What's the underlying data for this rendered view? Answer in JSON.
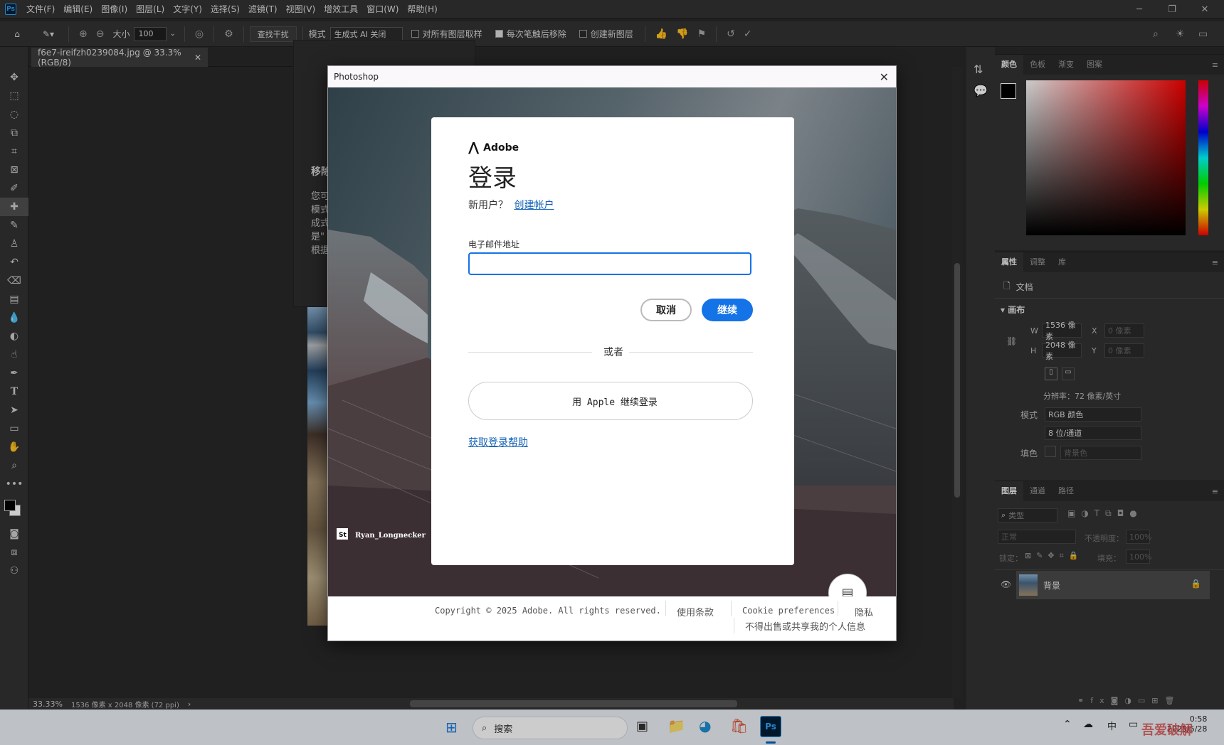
{
  "app": {
    "logo": "Ps",
    "menus": [
      "文件(F)",
      "编辑(E)",
      "图像(I)",
      "图层(L)",
      "文字(Y)",
      "选择(S)",
      "滤镜(T)",
      "视图(V)",
      "增效工具",
      "窗口(W)",
      "帮助(H)"
    ]
  },
  "options": {
    "size_label": "大小",
    "size_value": "100",
    "find_distraction": "查找干扰",
    "mode_label": "模式",
    "mode_value": "生成式 AI 关闭",
    "sample_all": "对所有图层取样",
    "remove_after_stroke": "每次笔触后移除",
    "create_layer": "创建新图层"
  },
  "document": {
    "tab_title": "f6e7-ireifzh0239084.jpg @ 33.3%(RGB/8)",
    "zoom": "33.33%",
    "info": "1536 像素 x 2048 像素 (72 ppi)"
  },
  "behind_popup": {
    "title": "移除",
    "lines": [
      "您可",
      "模式",
      "成式",
      "是\"",
      "根据"
    ]
  },
  "color_panel": {
    "tabs": [
      "颜色",
      "色板",
      "渐变",
      "图案"
    ]
  },
  "props_panel": {
    "tabs": [
      "属性",
      "调整",
      "库"
    ],
    "doc_label": "文档",
    "section": "画布",
    "w_label": "W",
    "w_value": "1536 像素",
    "x_label": "X",
    "x_value": "0 像素",
    "h_label": "H",
    "h_value": "2048 像素",
    "y_label": "Y",
    "y_value": "0 像素",
    "resolution": "分辨率：72 像素/英寸",
    "mode_label": "模式",
    "mode_value": "RGB 颜色",
    "depth_value": "8 位/通道",
    "fill_label": "填色",
    "fill_value": "背景色"
  },
  "layers_panel": {
    "tabs": [
      "图层",
      "通道",
      "路径"
    ],
    "filter": "类型",
    "blend": "正常",
    "opacity_label": "不透明度：",
    "opacity_value": "100%",
    "lock_label": "锁定：",
    "fill_label": "填充：",
    "fill_value": "100%",
    "layer_name": "背景"
  },
  "dialog": {
    "title": "Photoshop",
    "brand": "Adobe",
    "heading": "登录",
    "new_user": "新用户？",
    "create_account": "创建帐户",
    "email_label": "电子邮件地址",
    "email_value": "",
    "cancel": "取消",
    "continue": "继续",
    "or": "或者",
    "apple_login": "用 Apple 继续登录",
    "help": "获取登录帮助",
    "photo_credit": "Ryan_Longnecker",
    "copyright": "Copyright © 2025 Adobe. All rights reserved.",
    "terms": "使用条款",
    "cookie": "Cookie preferences",
    "privacy": "隐私",
    "no_sell": "不得出售或共享我的个人信息"
  },
  "taskbar": {
    "search": "搜索",
    "ime": "中",
    "time": "0:58",
    "date": "2025/5/28",
    "watermark": "吾爱破解"
  }
}
